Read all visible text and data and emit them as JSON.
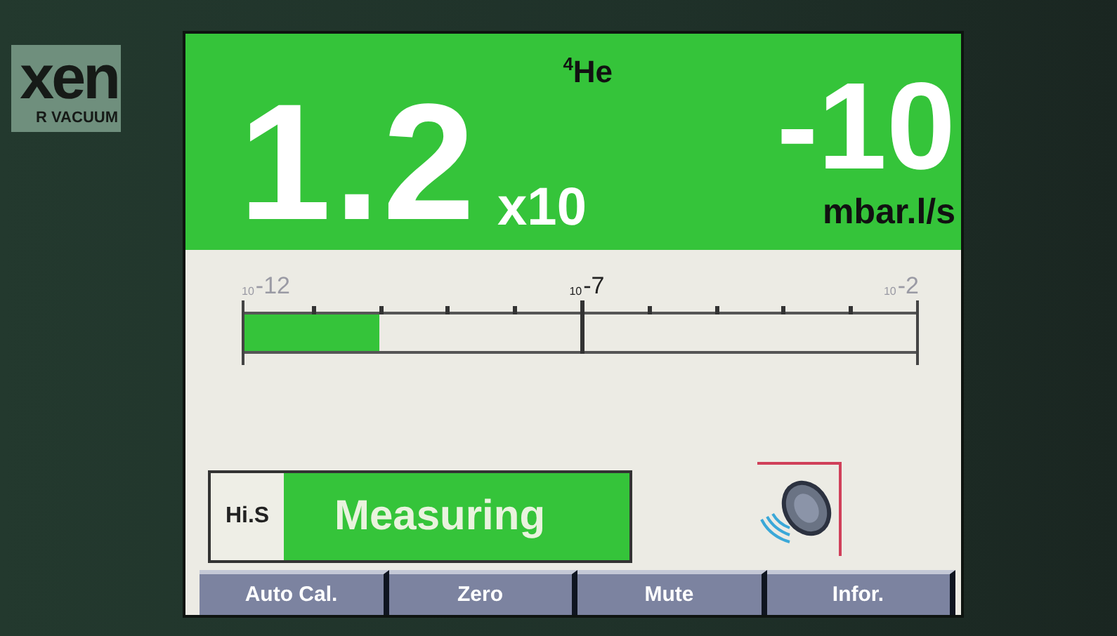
{
  "bezel": {
    "logo": "xen",
    "tagline": "R VACUUM"
  },
  "reading": {
    "gas": "$^{4}$He",
    "mantissa": "1.2",
    "multiplier": "x10",
    "exponent": "-10",
    "unit": "mbar.l/s"
  },
  "scale": {
    "labels": [
      {
        "base": "10",
        "exponent": "-12"
      },
      {
        "base": "10",
        "exponent": "-7"
      },
      {
        "base": "10",
        "exponent": "-2"
      }
    ],
    "level": 0.2
  },
  "status": {
    "mode": "Hi.S",
    "state": "Measuring"
  },
  "softkeys": [
    "Auto Cal.",
    "Zero",
    "Mute",
    "Infor."
  ]
}
